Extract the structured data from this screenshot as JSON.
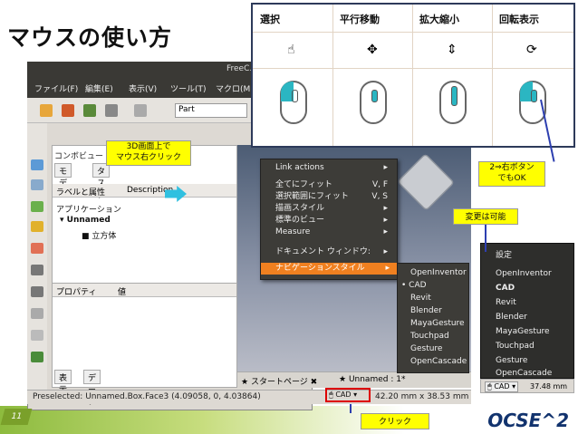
{
  "title": "マウスの使い方",
  "freecad": {
    "window_title": "FreeC...",
    "menu": [
      "ファイル(F)",
      "編集(E)",
      "表示(V)",
      "ツール(T)",
      "マクロ(M"
    ],
    "workbench": "Part",
    "panel_title": "コンボビュー",
    "tabs": [
      "モデル",
      "タスク"
    ],
    "tree_headers": [
      "ラベルと属性",
      "Description"
    ],
    "tree_root": "アプリケーション",
    "tree_doc": "Unnamed",
    "tree_item": "立方体",
    "prop_headers": [
      "プロパティ",
      "値"
    ],
    "bottom_tabs": [
      "表示",
      "データ"
    ],
    "status": "Preselected: Unnamed.Box.Face3 (4.09058, 0, 4.03864)",
    "page_tabs": [
      "スタートページ",
      "Unnamed : 1*"
    ],
    "nav_style": "CAD",
    "dims": "42.20 mm x 38.53 mm"
  },
  "context_menu": {
    "items": [
      {
        "label": "Link actions",
        "sc": "▸"
      },
      {
        "label": "全てにフィット",
        "sc": "V, F"
      },
      {
        "label": "選択範囲にフィット",
        "sc": "V, S"
      },
      {
        "label": "描画スタイル",
        "sc": "▸"
      },
      {
        "label": "標準のビュー",
        "sc": "▸"
      },
      {
        "label": "Measure",
        "sc": "▸"
      },
      {
        "label": "ドキュメント ウィンドウ:",
        "sc": "▸"
      },
      {
        "label": "ナビゲーションスタイル",
        "sc": "▸"
      }
    ]
  },
  "nav_submenu": [
    "OpenInventor",
    "CAD",
    "Revit",
    "Blender",
    "MayaGesture",
    "Touchpad",
    "Gesture",
    "OpenCascade"
  ],
  "right_menu": {
    "header": "設定",
    "items": [
      "OpenInventor",
      "CAD",
      "Revit",
      "Blender",
      "MayaGesture",
      "Touchpad",
      "Gesture",
      "OpenCascade"
    ],
    "cad": "CAD",
    "dims": "37.48 mm"
  },
  "mouse_table": {
    "headers": [
      "選択",
      "平行移動",
      "拡大縮小",
      "回転表示"
    ],
    "icons": [
      "pointer-icon",
      "move-icon",
      "zoom-icon",
      "rotate-icon"
    ]
  },
  "callouts": {
    "right_click": "3D画面上で\nマウス右クリック",
    "right_button": "2⇒右ボタン\nでもOK",
    "changeable": "変更は可能",
    "click": "クリック"
  },
  "slide_number": "11",
  "logo": "OCSE^2",
  "colors": {
    "accent": "#f08020",
    "callout": "#ffff00",
    "teal": "#2bb6c2",
    "green": "#8dbb3e",
    "navy": "#12336e"
  }
}
